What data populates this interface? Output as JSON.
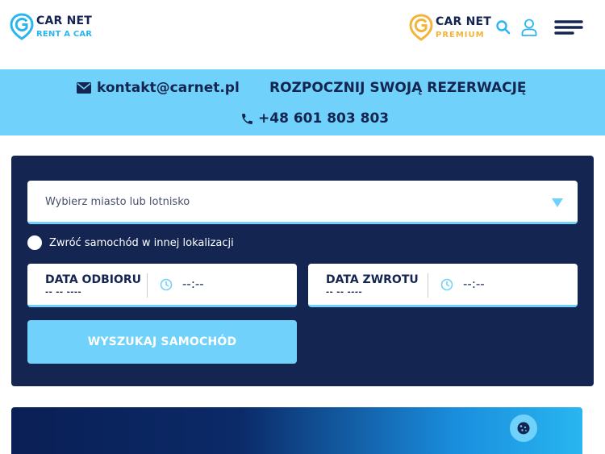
{
  "header": {
    "logo_main": {
      "title": "CAR NET",
      "subtitle": "RENT A CAR"
    },
    "logo_premium": {
      "title": "CAR NET",
      "subtitle": "PREMIUM"
    },
    "icons": {
      "search": "search-icon",
      "user": "user-icon",
      "menu": "hamburger-menu-icon"
    }
  },
  "contact_bar": {
    "email": "kontakt@carnet.pl",
    "booking_title": "ROZPOCZNIJ SWOJĄ REZERWACJĘ",
    "phone": "+48 601 803 803"
  },
  "booking_form": {
    "location_placeholder": "Wybierz miasto lub lotnisko",
    "return_other_location": "Zwróć samochód w innej lokalizacji",
    "pickup": {
      "label": "DATA ODBIORU",
      "date": "-- -- ----",
      "time": "--:--"
    },
    "dropoff": {
      "label": "DATA ZWROTU",
      "date": "-- -- ----",
      "time": "--:--"
    },
    "search_button": "WYSZUKAJ SAMOCHÓD"
  },
  "colors": {
    "navy": "#132550",
    "light_blue": "#70d2fa",
    "accent_blue": "#29b6f0",
    "premium_gold": "#f2b53a"
  }
}
